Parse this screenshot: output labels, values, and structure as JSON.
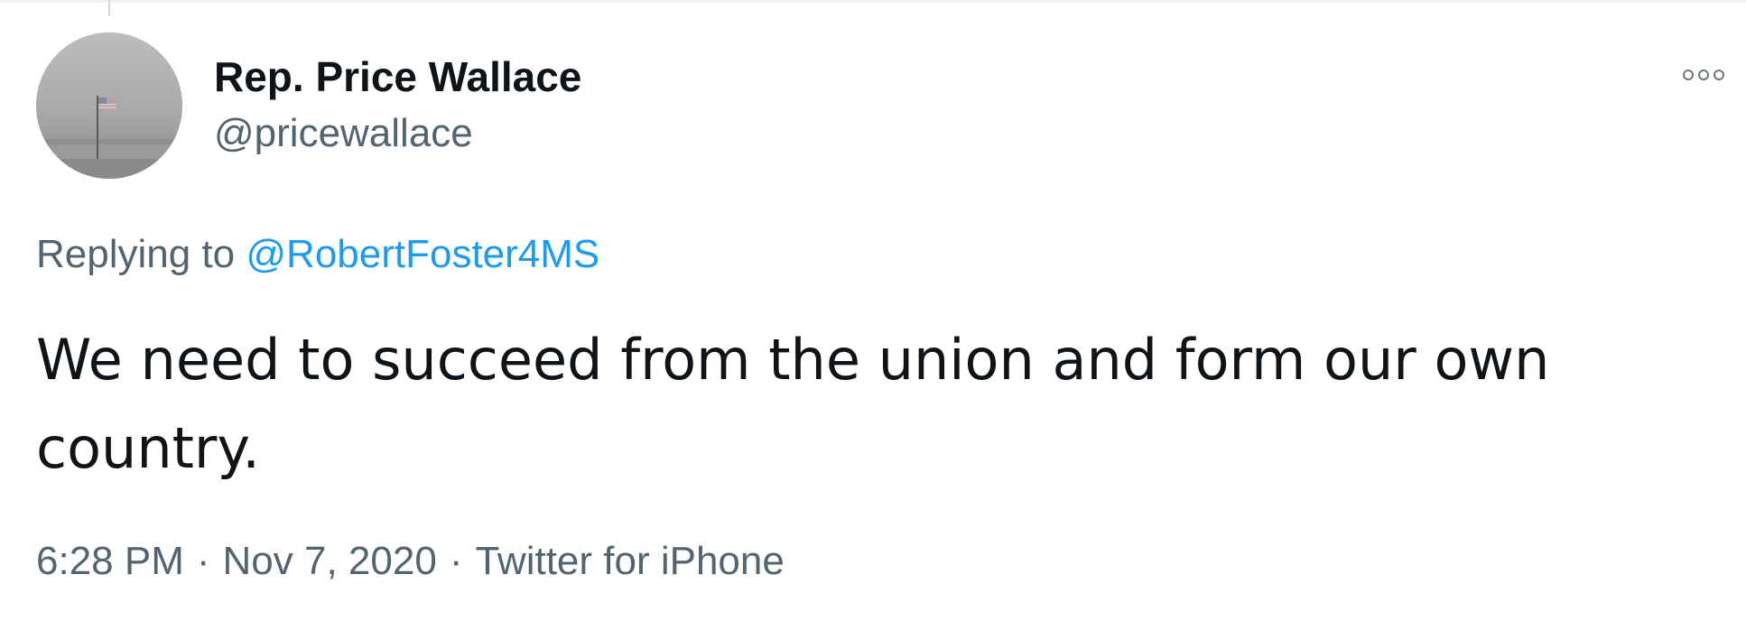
{
  "tweet": {
    "author": {
      "display_name": "Rep. Price Wallace",
      "handle": "@pricewallace",
      "avatar_icon": "flag-in-fog-photo"
    },
    "more_icon": "more-options-icon",
    "replying_to": {
      "prefix": "Replying to",
      "mention": "@RobertFoster4MS"
    },
    "text_lines": [
      "We need to succeed from the union and form our own",
      "country."
    ],
    "meta": {
      "time": "6:28 PM",
      "separator": "·",
      "date": "Nov 7, 2020",
      "source": "Twitter for iPhone"
    },
    "colors": {
      "text": "#0f1419",
      "secondary": "#536471",
      "link": "#1d9bf0"
    }
  }
}
